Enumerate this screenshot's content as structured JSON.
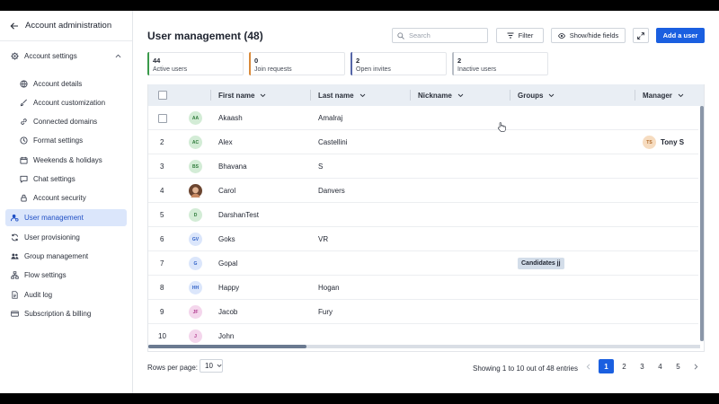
{
  "sidebar": {
    "title": "Account administration",
    "items": [
      {
        "label": "Account settings",
        "icon": "gear-icon"
      },
      {
        "label": "Account details",
        "icon": "globe-icon"
      },
      {
        "label": "Account customization",
        "icon": "brush-icon"
      },
      {
        "label": "Connected domains",
        "icon": "link-icon"
      },
      {
        "label": "Format settings",
        "icon": "clock-icon"
      },
      {
        "label": "Weekends & holidays",
        "icon": "calendar-icon"
      },
      {
        "label": "Chat settings",
        "icon": "chat-icon"
      },
      {
        "label": "Account security",
        "icon": "lock-icon"
      },
      {
        "label": "User management",
        "icon": "user-gear-icon"
      },
      {
        "label": "User provisioning",
        "icon": "sync-icon"
      },
      {
        "label": "Group management",
        "icon": "group-icon"
      },
      {
        "label": "Flow settings",
        "icon": "flow-icon"
      },
      {
        "label": "Audit log",
        "icon": "document-icon"
      },
      {
        "label": "Subscription & billing",
        "icon": "card-icon"
      }
    ]
  },
  "header": {
    "title": "User management (48)",
    "search_placeholder": "Search",
    "filter_label": "Filter",
    "show_hide_label": "Show/hide fields",
    "add_user_label": "Add a user"
  },
  "stats": [
    {
      "value": "44",
      "label": "Active users",
      "color": "#3a9a4a"
    },
    {
      "value": "0",
      "label": "Join requests",
      "color": "#d98a3a"
    },
    {
      "value": "2",
      "label": "Open invites",
      "color": "#5566a8"
    },
    {
      "value": "2",
      "label": "Inactive users",
      "color": "#b9bec6"
    }
  ],
  "table": {
    "columns": [
      "First name",
      "Last name",
      "Nickname",
      "Groups",
      "Manager"
    ],
    "rows": [
      {
        "index": "",
        "initials": "AA",
        "first": "Akaash",
        "last": "Amalraj",
        "group": "",
        "manager": "",
        "manager_initials": ""
      },
      {
        "index": "2",
        "initials": "AC",
        "first": "Alex",
        "last": "Castellini",
        "group": "",
        "manager": "Tony S",
        "manager_initials": "TS"
      },
      {
        "index": "3",
        "initials": "BS",
        "first": "Bhavana",
        "last": "S",
        "group": "",
        "manager": "",
        "manager_initials": ""
      },
      {
        "index": "4",
        "initials": "",
        "first": "Carol",
        "last": "Danvers",
        "group": "",
        "manager": "",
        "manager_initials": ""
      },
      {
        "index": "5",
        "initials": "D",
        "first": "DarshanTest",
        "last": "",
        "group": "",
        "manager": "",
        "manager_initials": ""
      },
      {
        "index": "6",
        "initials": "GV",
        "first": "Goks",
        "last": "VR",
        "group": "",
        "manager": "",
        "manager_initials": ""
      },
      {
        "index": "7",
        "initials": "G",
        "first": "Gopal",
        "last": "",
        "group": "Candidates jj",
        "manager": "",
        "manager_initials": ""
      },
      {
        "index": "8",
        "initials": "HH",
        "first": "Happy",
        "last": "Hogan",
        "group": "",
        "manager": "",
        "manager_initials": ""
      },
      {
        "index": "9",
        "initials": "JF",
        "first": "Jacob",
        "last": "Fury",
        "group": "",
        "manager": "",
        "manager_initials": ""
      },
      {
        "index": "10",
        "initials": "J",
        "first": "John",
        "last": "",
        "group": "",
        "manager": "",
        "manager_initials": ""
      }
    ]
  },
  "footer": {
    "rows_per_page_label": "Rows per page:",
    "rows_per_page_value": "10",
    "entries_text": "Showing 1 to 10 out of 48 entries",
    "pages": [
      "1",
      "2",
      "3",
      "4",
      "5"
    ],
    "current_page": "1"
  }
}
